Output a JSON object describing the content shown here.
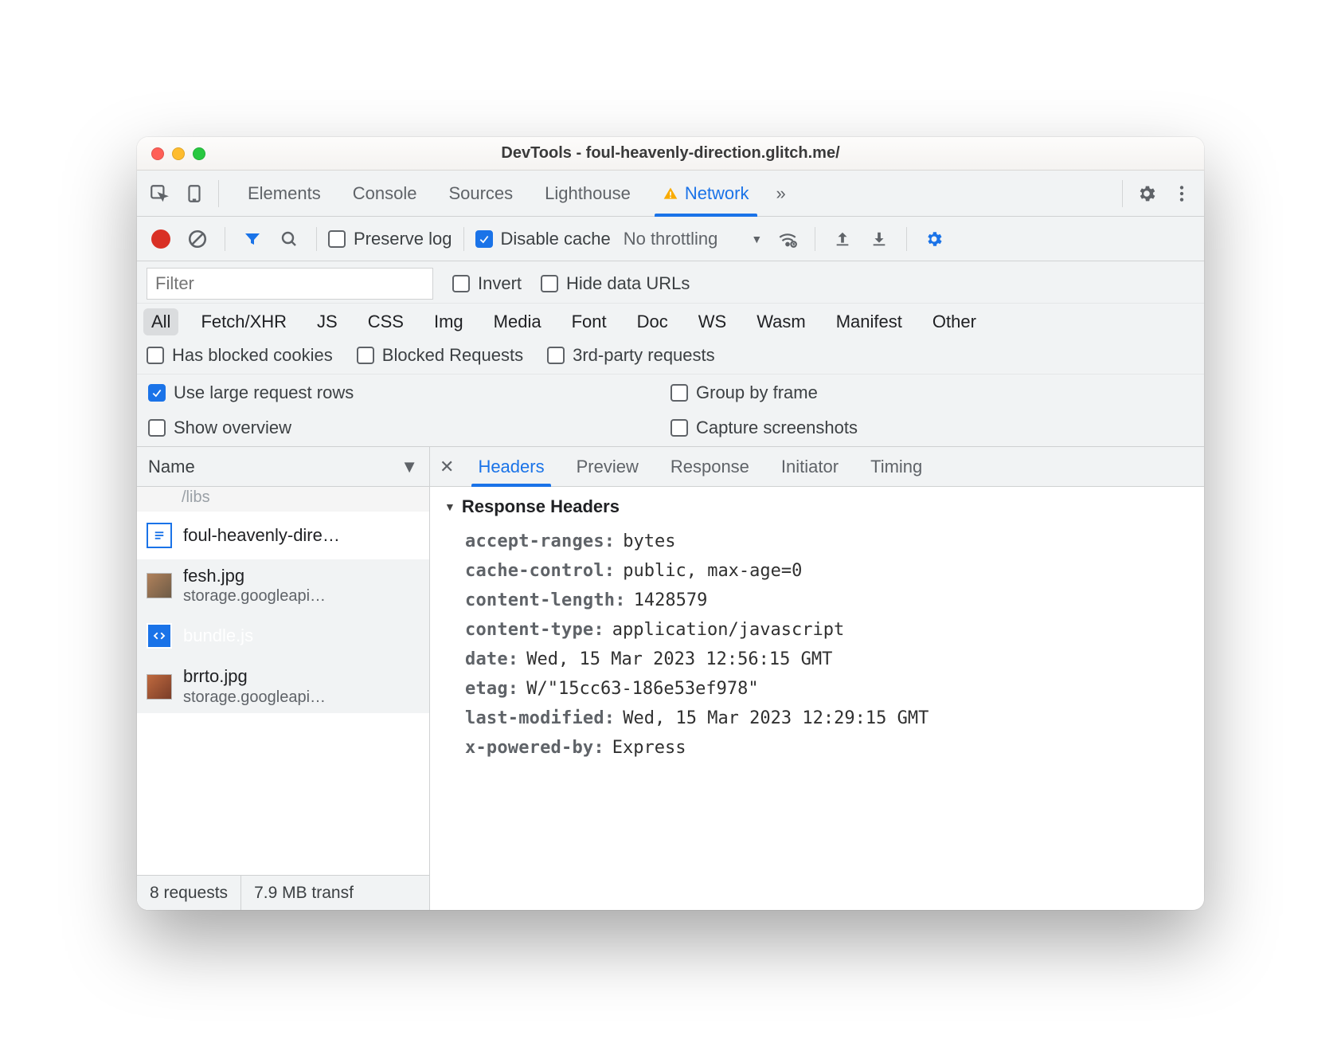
{
  "window": {
    "title": "DevTools - foul-heavenly-direction.glitch.me/"
  },
  "tabs": {
    "items": [
      "Elements",
      "Console",
      "Sources",
      "Lighthouse",
      "Network"
    ],
    "active": "Network",
    "warn_on": "Network"
  },
  "toolbar": {
    "preserve_log": "Preserve log",
    "disable_cache": "Disable cache",
    "throttling": "No throttling"
  },
  "filter": {
    "placeholder": "Filter",
    "invert": "Invert",
    "hide_data_urls": "Hide data URLs"
  },
  "types": [
    "All",
    "Fetch/XHR",
    "JS",
    "CSS",
    "Img",
    "Media",
    "Font",
    "Doc",
    "WS",
    "Wasm",
    "Manifest",
    "Other"
  ],
  "checks": {
    "blocked_cookies": "Has blocked cookies",
    "blocked_requests": "Blocked Requests",
    "third_party": "3rd-party requests"
  },
  "settings": {
    "large_rows": "Use large request rows",
    "group_by_frame": "Group by frame",
    "show_overview": "Show overview",
    "capture_screenshots": "Capture screenshots"
  },
  "list": {
    "header": "Name",
    "partial_first": "/libs",
    "rows": [
      {
        "kind": "doc",
        "name": "foul-heavenly-dire…",
        "sub": ""
      },
      {
        "kind": "img",
        "name": "fesh.jpg",
        "sub": "storage.googleapi…"
      },
      {
        "kind": "js",
        "name": "bundle.js",
        "sub": "",
        "selected": true
      },
      {
        "kind": "img2",
        "name": "brrto.jpg",
        "sub": "storage.googleapi…"
      }
    ]
  },
  "status": {
    "requests": "8 requests",
    "transfer": "7.9 MB transf"
  },
  "detail": {
    "tabs": [
      "Headers",
      "Preview",
      "Response",
      "Initiator",
      "Timing"
    ],
    "active": "Headers",
    "section": "Response Headers",
    "headers": [
      {
        "k": "accept-ranges:",
        "v": "bytes"
      },
      {
        "k": "cache-control:",
        "v": "public, max-age=0"
      },
      {
        "k": "content-length:",
        "v": "1428579"
      },
      {
        "k": "content-type:",
        "v": "application/javascript"
      },
      {
        "k": "date:",
        "v": "Wed, 15 Mar 2023 12:56:15 GMT"
      },
      {
        "k": "etag:",
        "v": "W/\"15cc63-186e53ef978\""
      },
      {
        "k": "last-modified:",
        "v": "Wed, 15 Mar 2023 12:29:15 GMT"
      },
      {
        "k": "x-powered-by:",
        "v": "Express"
      }
    ]
  }
}
